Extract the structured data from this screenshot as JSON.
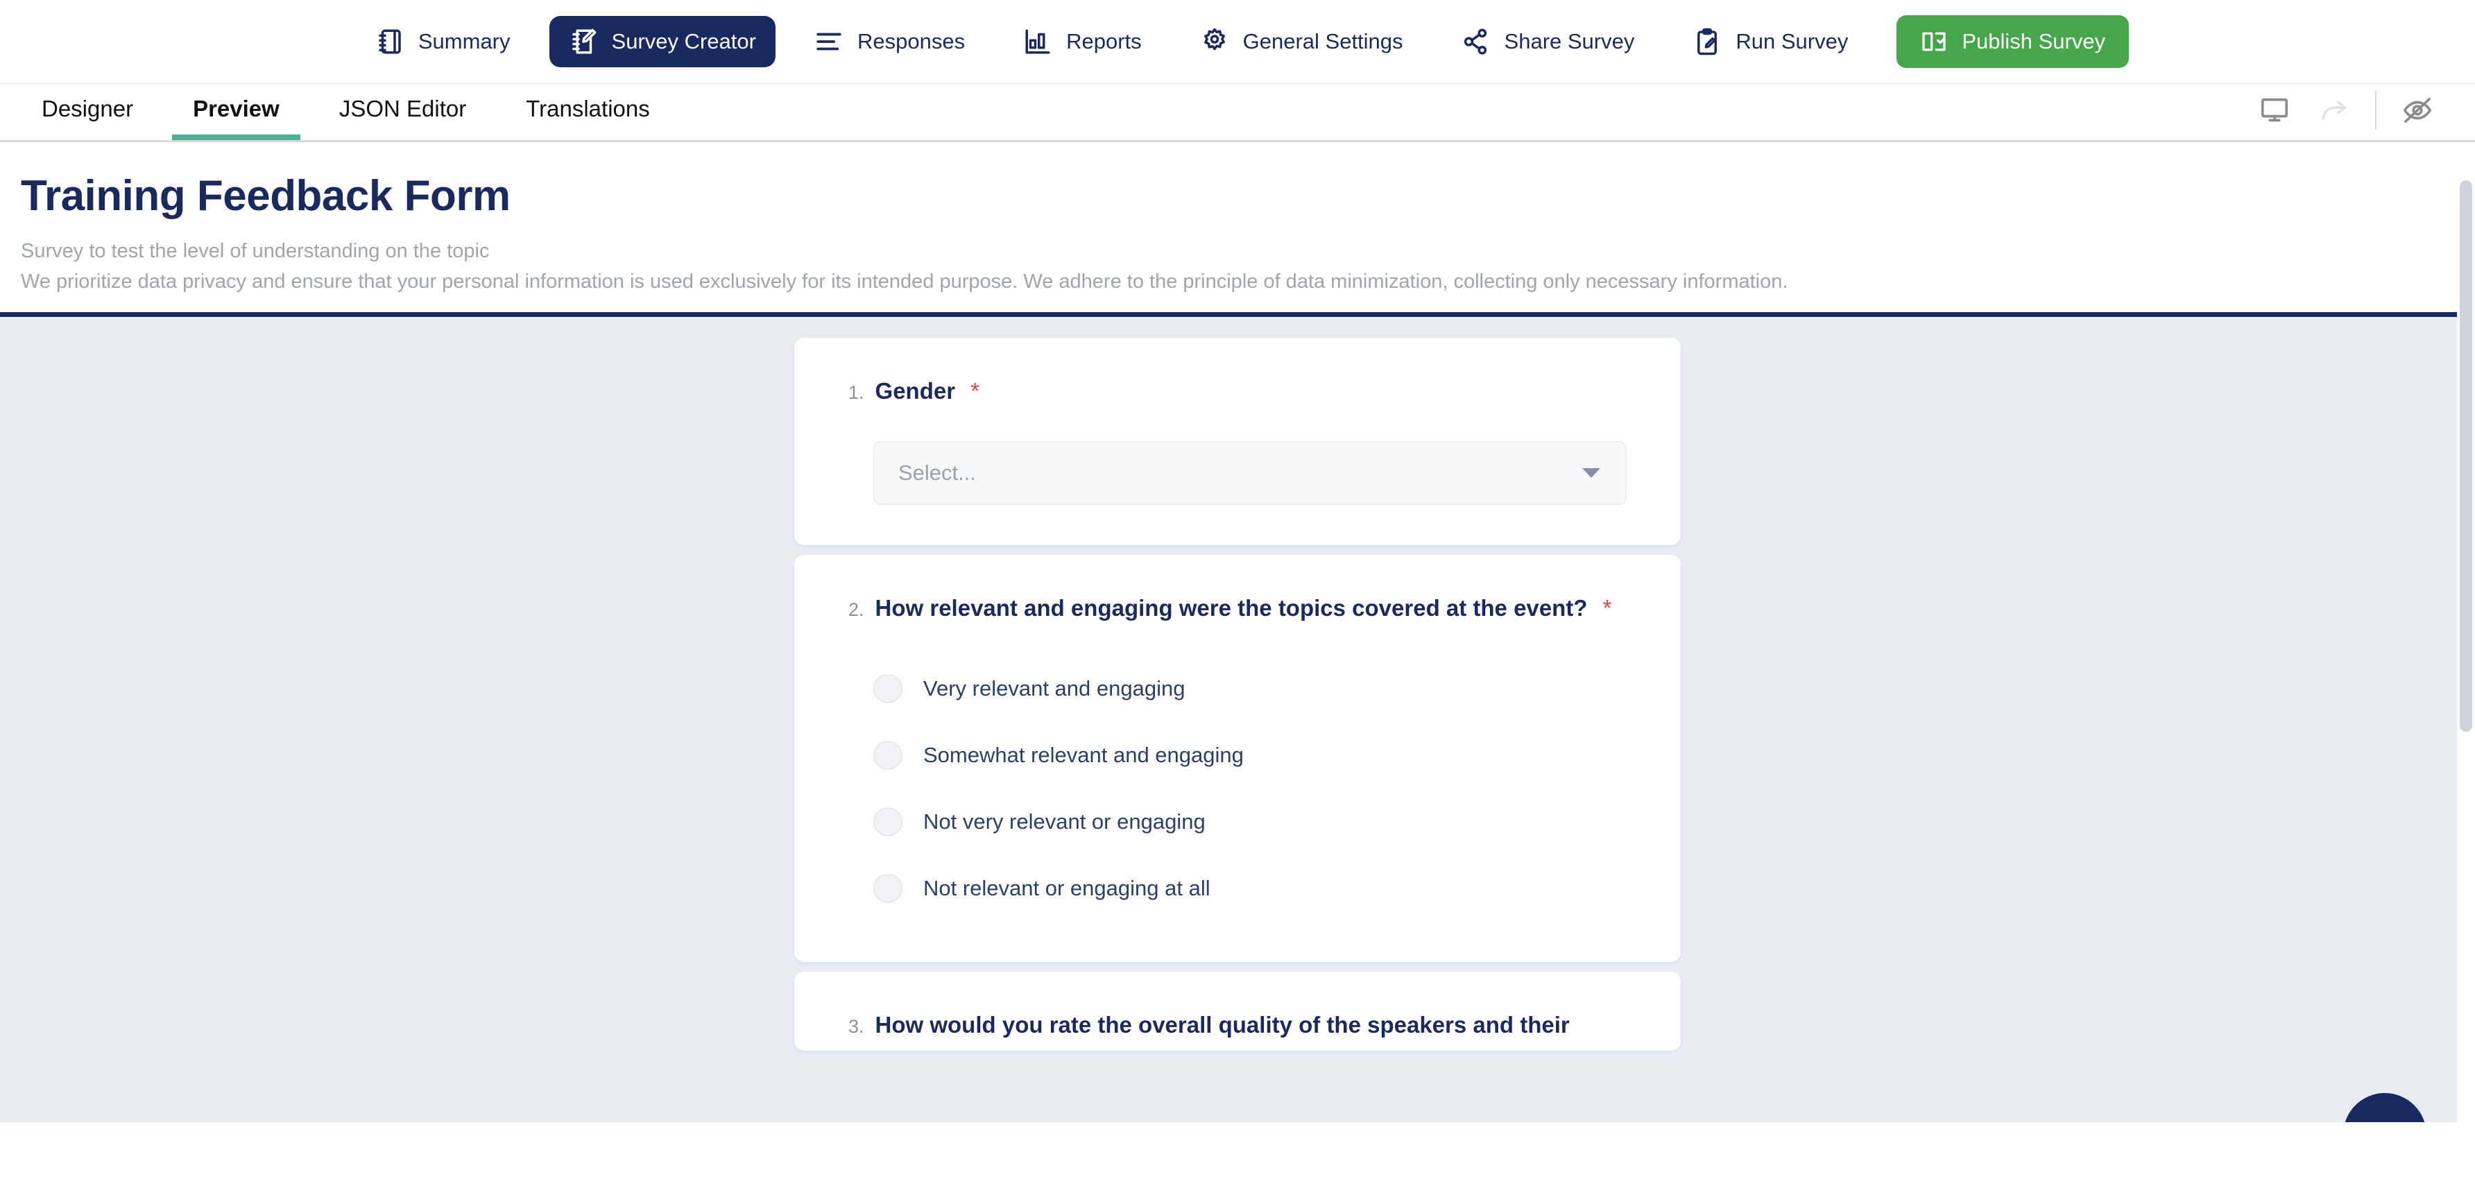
{
  "topnav": {
    "items": [
      {
        "label": "Summary",
        "icon": "notebook-icon",
        "active": false
      },
      {
        "label": "Survey Creator",
        "icon": "notebook-pencil-icon",
        "active": true
      },
      {
        "label": "Responses",
        "icon": "list-lines-icon",
        "active": false
      },
      {
        "label": "Reports",
        "icon": "bar-chart-icon",
        "active": false
      },
      {
        "label": "General Settings",
        "icon": "gear-icon",
        "active": false
      },
      {
        "label": "Share Survey",
        "icon": "share-nodes-icon",
        "active": false
      },
      {
        "label": "Run Survey",
        "icon": "clipboard-pencil-icon",
        "active": false
      }
    ],
    "publish": {
      "label": "Publish Survey",
      "icon": "book-check-icon",
      "color": "#47a54c"
    },
    "active_bg": "#17295e",
    "text_color": "#1b2a5e"
  },
  "tabbar": {
    "tabs": [
      {
        "label": "Designer",
        "active": false
      },
      {
        "label": "Preview",
        "active": true
      },
      {
        "label": "JSON Editor",
        "active": false
      },
      {
        "label": "Translations",
        "active": false
      }
    ],
    "active_underline_color": "#4db095",
    "actions": [
      {
        "name": "device-preview-icon",
        "label": "Desktop preview"
      },
      {
        "name": "redo-icon",
        "label": "Redo"
      },
      {
        "name": "eye-off-icon",
        "label": "Hide invisible elements"
      }
    ]
  },
  "survey": {
    "title": "Training Feedback Form",
    "description_line1": "Survey to test the level of understanding on the topic",
    "description_line2": "We prioritize data privacy and ensure that your personal information is used exclusively for its intended purpose. We adhere to the principle of data minimization, collecting only necessary information.",
    "header_border_color": "#17295e",
    "body_bg": "#e9edf2"
  },
  "questions": [
    {
      "number": "1.",
      "title": "Gender",
      "required": "*",
      "type": "dropdown",
      "placeholder": "Select..."
    },
    {
      "number": "2.",
      "title": "How relevant and engaging were the topics covered at the event?",
      "required": "*",
      "type": "radiogroup",
      "options": [
        "Very relevant and engaging",
        "Somewhat relevant and engaging",
        "Not very relevant or engaging",
        "Not relevant or engaging at all"
      ]
    },
    {
      "number": "3.",
      "title": "How would you rate the overall quality of the speakers and their",
      "required": "",
      "type": "partial"
    }
  ]
}
